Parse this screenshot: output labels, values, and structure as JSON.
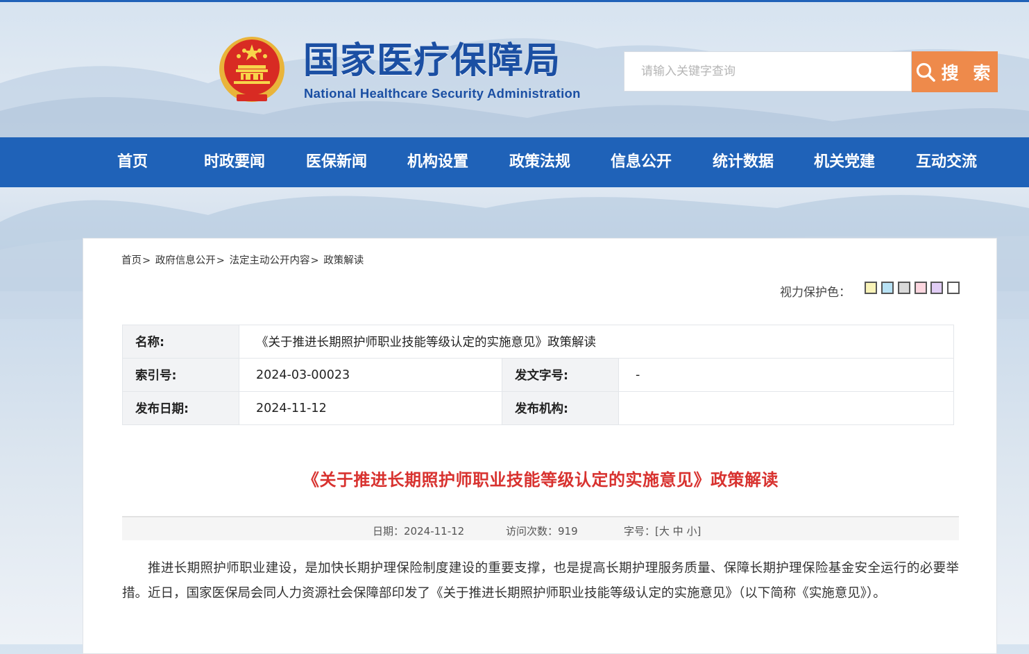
{
  "header": {
    "title_cn": "国家医疗保障局",
    "title_en": "National Healthcare Security Administration",
    "search": {
      "placeholder": "请输入关键字查询",
      "button_label": "搜 索",
      "button_color": "#ee8a4b"
    },
    "emblem_icon": "national-emblem-icon"
  },
  "nav": {
    "color": "#1f62b8",
    "items": [
      "首页",
      "时政要闻",
      "医保新闻",
      "机构设置",
      "政策法规",
      "信息公开",
      "统计数据",
      "机关党建",
      "互动交流"
    ]
  },
  "breadcrumb": [
    "首页",
    "政府信息公开",
    "法定主动公开内容",
    "政策解读"
  ],
  "eye_protection": {
    "label": "视力保护色：",
    "swatches": [
      "#f9f3b8",
      "#b8e2f5",
      "#d9d9d9",
      "#fcd6df",
      "#e1cdf5",
      "#ffffff"
    ]
  },
  "info": {
    "name_label": "名称:",
    "name_value": "《关于推进长期照护师职业技能等级认定的实施意见》政策解读",
    "index_label": "索引号:",
    "index_value": "2024-03-00023",
    "docno_label": "发文字号:",
    "docno_value": "-",
    "date_label": "发布日期:",
    "date_value": "2024-11-12",
    "org_label": "发布机构:",
    "org_value": ""
  },
  "article": {
    "title": "《关于推进长期照护师职业技能等级认定的实施意见》政策解读",
    "title_color": "#d8322f",
    "meta": {
      "date_label": "日期：",
      "date_value": "2024-11-12",
      "visits_label": "访问次数：",
      "visits_value": "919",
      "fontsize_label": "字号：[",
      "fontsize_options": [
        "大",
        "中",
        "小"
      ],
      "fontsize_close": "]"
    },
    "paragraph": "推进长期照护师职业建设，是加快长期护理保险制度建设的重要支撑，也是提高长期护理服务质量、保障长期护理保险基金安全运行的必要举措。近日，国家医保局会同人力资源社会保障部印发了《关于推进长期照护师职业技能等级认定的实施意见》（以下简称《实施意见》）。"
  }
}
